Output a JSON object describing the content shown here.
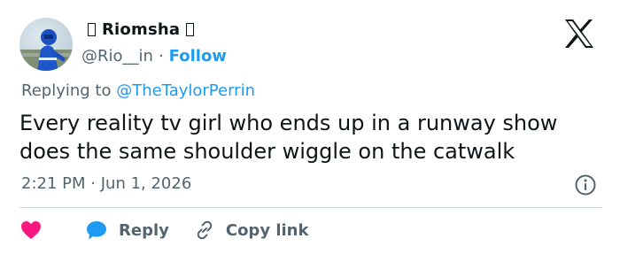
{
  "tweet": {
    "author": {
      "display_name": "Riomsha",
      "handle": "@Rio__in",
      "separator": "·",
      "follow_label": "Follow"
    },
    "replying_prefix": "Replying to",
    "replying_to": "@TheTaylorPerrin",
    "text_lines": [
      "Every reality tv girl who ends up in a runway show",
      "does the same shoulder wiggle on the catwalk"
    ],
    "time": "2:21 PM",
    "meta_separator": "·",
    "date": "Jun 1, 2026"
  },
  "actions": {
    "reply_label": "Reply",
    "copy_link_label": "Copy link"
  },
  "colors": {
    "accent": "#1d9bf0",
    "like": "#f91880",
    "text": "#0f1419",
    "muted": "#536471",
    "divider": "#cfd9de"
  },
  "icons": {
    "brand": "x-logo-icon",
    "info": "info-icon",
    "like": "heart-icon",
    "reply": "speech-bubble-icon",
    "copy": "link-icon",
    "name_decoration": "glyph-box-icon"
  }
}
